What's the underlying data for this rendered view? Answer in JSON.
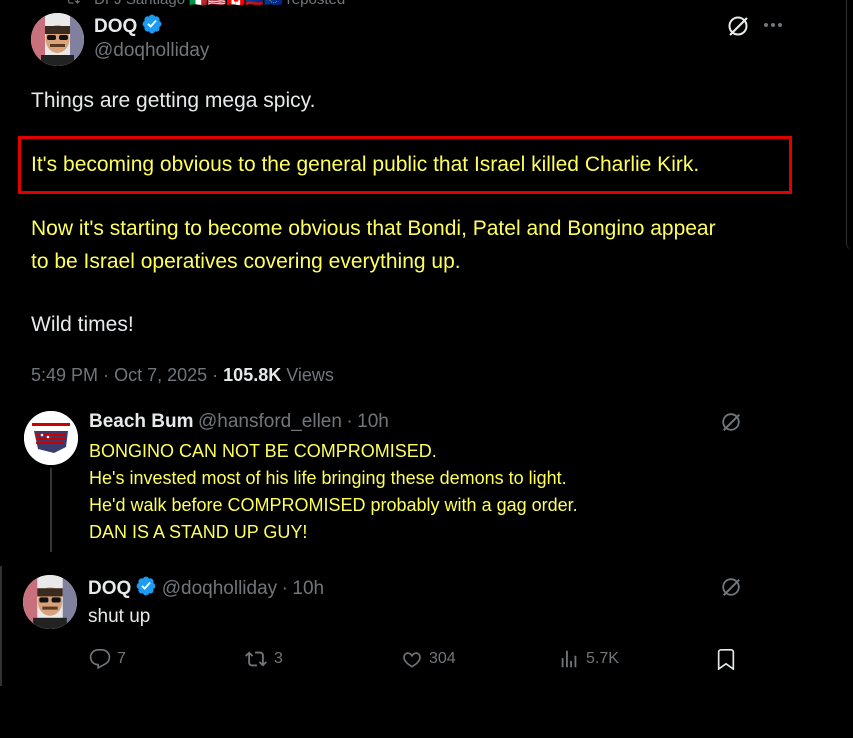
{
  "repost": {
    "user": "DFJ Santiago",
    "flags": "🇮🇹🇺🇸🇨🇦🇨🇴🇪🇺",
    "label": "reposted"
  },
  "post": {
    "display_name": "DOQ",
    "handle": "@doqholliday",
    "paragraphs": [
      "Things are getting mega spicy.",
      "It's becoming obvious to the general public that Israel killed Charlie Kirk.",
      "Now it's starting to become obvious that Bondi, Patel and Bongino appear to be Israel operatives covering everything up.",
      "Wild times!"
    ],
    "time": "5:49 PM",
    "separator": "·",
    "date": "Oct 7, 2025",
    "views_count": "105.8K",
    "views_label": "Views"
  },
  "reply1": {
    "display_name": "Beach Bum",
    "handle": "@hansford_ellen",
    "age": "10h",
    "lines": [
      "BONGINO CAN NOT BE COMPROMISED.",
      "He's invested most of his life bringing these demons to light.",
      "He'd walk before COMPROMISED probably with a gag order.",
      "DAN IS A STAND UP GUY!"
    ]
  },
  "reply2": {
    "display_name": "DOQ",
    "handle": "@doqholliday",
    "age": "10h",
    "text": "shut up",
    "replies": "7",
    "reposts": "3",
    "likes": "304",
    "views": "5.7K"
  },
  "colors": {
    "background": "#000000",
    "highlight_border": "#e00000",
    "yellow_text": "#ffff5c",
    "verified": "#1d9bf0",
    "muted": "#71767b"
  },
  "icons": [
    "grok-icon",
    "more-icon",
    "verified-badge-icon",
    "reply-icon",
    "repost-icon",
    "like-icon",
    "views-icon",
    "bookmark-icon",
    "repost-small-icon"
  ]
}
